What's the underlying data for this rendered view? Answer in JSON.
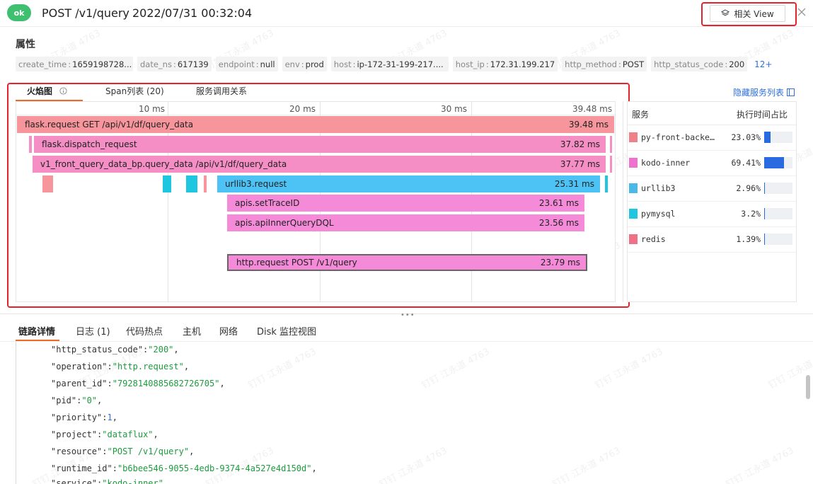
{
  "header": {
    "status": "ok",
    "title": "POST /v1/query",
    "time": "2022/07/31 00:32:04",
    "view_button": "相关 View"
  },
  "attributes": {
    "title": "属性",
    "tags": [
      {
        "key": "create_time",
        "value": "1659198728..."
      },
      {
        "key": "date_ns",
        "value": "617139"
      },
      {
        "key": "endpoint",
        "value": "null"
      },
      {
        "key": "env",
        "value": "prod"
      },
      {
        "key": "host",
        "value": "ip-172-31-199-217...."
      },
      {
        "key": "host_ip",
        "value": "172.31.199.217"
      },
      {
        "key": "http_method",
        "value": "POST"
      },
      {
        "key": "http_status_code",
        "value": "200"
      }
    ],
    "more": "12+"
  },
  "tabs": {
    "flame": "火焰图",
    "span_list": "Span列表 (20)",
    "service_map": "服务调用关系",
    "hide_services": "隐藏服务列表"
  },
  "flame": {
    "ticks": [
      "10 ms",
      "20 ms",
      "30 ms",
      "39.48 ms"
    ],
    "spans": [
      {
        "name": "flask.request GET /api/v1/df/query_data",
        "duration": "39.48 ms"
      },
      {
        "name": "flask.dispatch_request",
        "duration": "37.82 ms"
      },
      {
        "name": "v1_front_query_data_bp.query_data /api/v1/df/query_data",
        "duration": "37.77 ms"
      },
      {
        "name": "urllib3.request",
        "duration": "25.31 ms"
      },
      {
        "name": "apis.setTraceID",
        "duration": "23.61 ms"
      },
      {
        "name": "apis.apiInnerQueryDQL",
        "duration": "23.56 ms"
      },
      {
        "name": "http.request POST /v1/query",
        "duration": "23.79 ms"
      }
    ]
  },
  "services": {
    "header_service": "服务",
    "header_ratio": "执行时间占比",
    "rows": [
      {
        "name": "py-front-backend",
        "pct": "23.03%",
        "ratio": 0.2303,
        "color": "#f0808a"
      },
      {
        "name": "kodo-inner",
        "pct": "69.41%",
        "ratio": 0.6941,
        "color": "#f070d0"
      },
      {
        "name": "urllib3",
        "pct": "2.96%",
        "ratio": 0.0296,
        "color": "#4ab8e8"
      },
      {
        "name": "pymysql",
        "pct": "3.2%",
        "ratio": 0.032,
        "color": "#20c6df"
      },
      {
        "name": "redis",
        "pct": "1.39%",
        "ratio": 0.0139,
        "color": "#f07088"
      }
    ]
  },
  "bottom_tabs": [
    "链路详情",
    "日志 (1)",
    "代码热点",
    "主机",
    "网络",
    "Disk 监控视图"
  ],
  "detail": [
    {
      "key": "\"http_status_code\"",
      "value": "\"200\"",
      "type": "string"
    },
    {
      "key": "\"operation\"",
      "value": "\"http.request\"",
      "type": "string"
    },
    {
      "key": "\"parent_id\"",
      "value": "\"7928140885682726705\"",
      "type": "string"
    },
    {
      "key": "\"pid\"",
      "value": "\"0\"",
      "type": "string"
    },
    {
      "key": "\"priority\"",
      "value": "1",
      "type": "number"
    },
    {
      "key": "\"project\"",
      "value": "\"dataflux\"",
      "type": "string"
    },
    {
      "key": "\"resource\"",
      "value": "\"POST /v1/query\"",
      "type": "string"
    },
    {
      "key": "\"runtime_id\"",
      "value": "\"b6bee546-9055-4edb-9374-4a527e4d150d\"",
      "type": "string"
    },
    {
      "key": "\"service\"",
      "value": "\"kodo-inner\"",
      "type": "string"
    }
  ],
  "watermark": "钉钉 江永道 4763",
  "colors": {
    "ok": "#3fc070",
    "accent": "#ea6a27",
    "link": "#2f6fdf",
    "highlight_border": "#e4232a"
  }
}
